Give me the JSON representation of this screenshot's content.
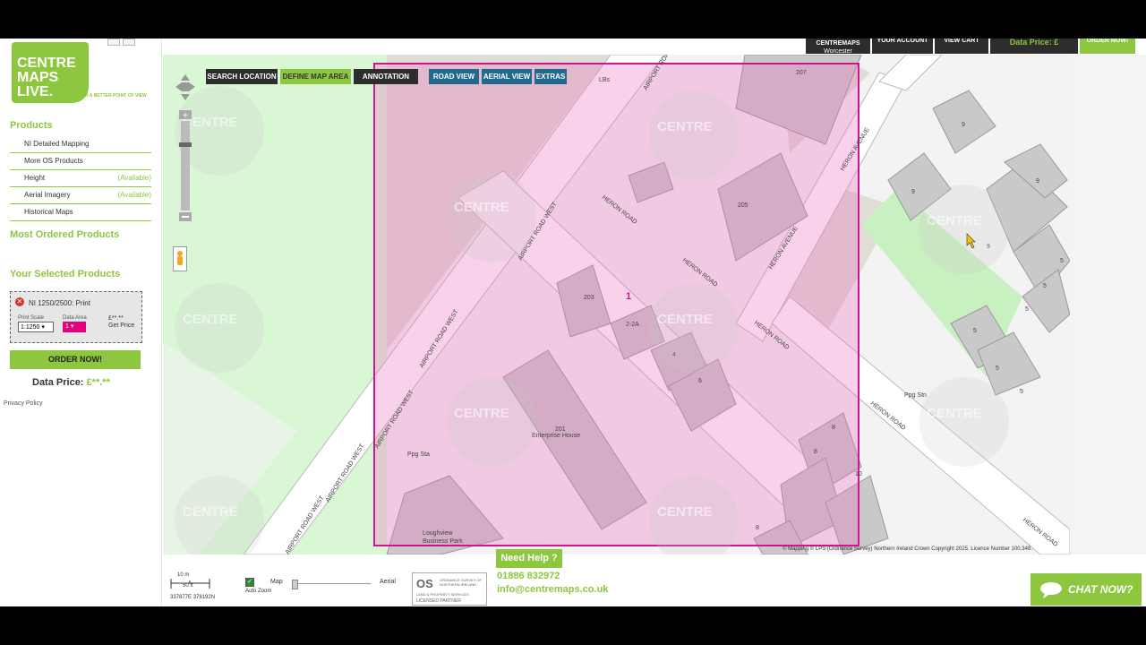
{
  "sidebar": {
    "logo_text": [
      "CENTRE",
      "MAPS",
      "LIVE."
    ],
    "tagline": "FOR A BETTER POINT OF VIEW",
    "products_heading": "Products",
    "products": [
      {
        "label": "NI Detailed Mapping",
        "status": ""
      },
      {
        "label": "More OS Products",
        "status": ""
      },
      {
        "label": "Height",
        "status": "(Available)"
      },
      {
        "label": "Aerial Imagery",
        "status": "(Available)"
      },
      {
        "label": "Historical Maps",
        "status": ""
      }
    ],
    "most_ordered": "Most Ordered Products",
    "selected_heading": "Your Selected Products",
    "selected": {
      "name": "NI 1250/2500: Print",
      "print_scale_label": "Print Scale",
      "print_scale_value": "1:1250",
      "data_area_label": "Data Area",
      "data_area_value": "1",
      "price_value": "£**.**",
      "get_price": "Get Price"
    },
    "order_button": "ORDER NOW!",
    "data_price_label": "Data Price:",
    "data_price_value": "£**.**",
    "privacy": "Privacy Policy"
  },
  "topbar": {
    "centremaps": "CENTREMAPS",
    "location": "Worcester",
    "your_account": "YOUR ACCOUNT",
    "view_cart": "VIEW CART",
    "data_price": "Data Price: £",
    "order_now": "ORDER NOW!",
    "close": "X"
  },
  "toolbar": {
    "search_location": "SEARCH LOCATION",
    "define_map_area": "DEFINE MAP AREA",
    "annotation": "ANNOTATION",
    "road_view": "ROAD VIEW",
    "aerial_view": "AERIAL VIEW",
    "extras": "EXTRAS"
  },
  "map": {
    "labels": {
      "lbs": "LBs",
      "airport_road": "AIRPORT ROAD",
      "airport_road_west": "AIRPORT ROAD WEST",
      "heron_road": "HERON ROAD",
      "heron_avenue": "HERON AVENUE",
      "enterprise_house": "Enterprise House",
      "ppg_sta": "Ppg Sta",
      "ppg_stn": "Ppg Stn",
      "loughview": "Loughview",
      "business_park": "Business Park",
      "area_number": "1"
    },
    "numbers": [
      "207",
      "205",
      "203",
      "2-2A",
      "4",
      "6",
      "201",
      "8",
      "8",
      "10",
      "9",
      "9",
      "9",
      "9",
      "5",
      "5",
      "5",
      "5",
      "5",
      "5",
      "8"
    ],
    "watermark": "CENTRE MAPS LIVE.",
    "copyright": "© Mapping © LPS (Ordnance Survey) Northern Ireland Crown Copyright 2025. Licence Number 100,348."
  },
  "bottom": {
    "scale_m": "10 m",
    "scale_ft": "50 ft",
    "coords": "337877E 378192N",
    "auto_zoom": "Auto Zoom",
    "map": "Map",
    "aerial": "Aerial",
    "need_help": "Need Help ?",
    "phone": "01886 832972",
    "email": "info@centremaps.co.uk",
    "chat": "CHAT NOW?",
    "partner_lines": [
      "ORDNANCE SURVEY OF NORTHERN IRELAND",
      "LAND & PROPERTY SERVICES",
      "LICENSED PARTNER"
    ]
  },
  "colors": {
    "accent": "#8dc63f",
    "magenta": "#e6007e",
    "dark": "#2d2d2d",
    "blue_tab": "#1f6a8e"
  }
}
